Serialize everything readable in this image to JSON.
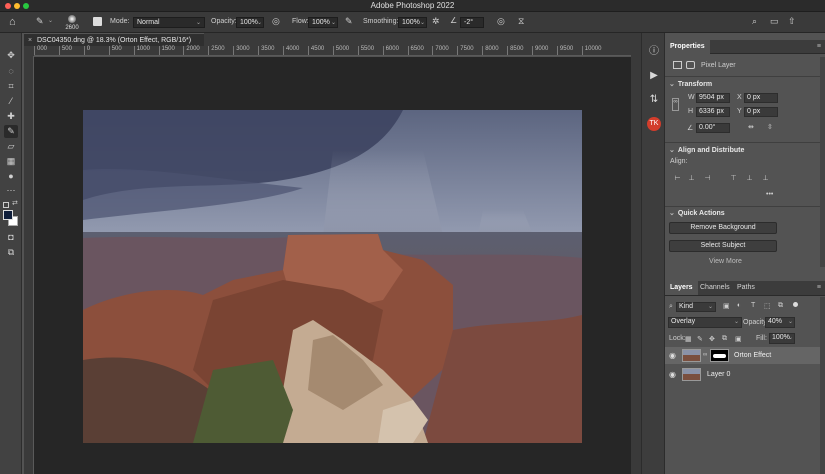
{
  "app": {
    "title": "Adobe Photoshop 2022"
  },
  "options_bar": {
    "brush_size": "2600",
    "mode_label": "Mode:",
    "mode_value": "Normal",
    "opacity_label": "Opacity:",
    "opacity_value": "100%",
    "flow_label": "Flow:",
    "flow_value": "100%",
    "smoothing_label": "Smoothing:",
    "smoothing_value": "100%",
    "angle_value": "-2°"
  },
  "document": {
    "tab_title": "DSC04350.dng @ 18.3% (Orton Effect, RGB/16*)",
    "close_glyph": "×"
  },
  "ruler": {
    "ticks": [
      "000",
      "500",
      "0",
      "500",
      "1000",
      "1500",
      "2000",
      "2500",
      "3000",
      "3500",
      "4000",
      "4500",
      "5000",
      "5500",
      "6000",
      "6500",
      "7000",
      "7500",
      "8000",
      "8500",
      "9000",
      "9500",
      "10000"
    ]
  },
  "properties": {
    "tab_label": "Properties",
    "pixel_layer_label": "Pixel Layer",
    "transform_label": "Transform",
    "w_label": "W",
    "w_value": "9504 px",
    "h_label": "H",
    "h_value": "6336 px",
    "x_label": "X",
    "x_value": "0 px",
    "y_label": "Y",
    "y_value": "0 px",
    "angle_value": "0.00°",
    "align_label": "Align and Distribute",
    "align_sub": "Align:",
    "more_glyph": "•••",
    "quick_actions_label": "Quick Actions",
    "remove_bg_button": "Remove Background",
    "select_subject_button": "Select Subject",
    "view_more": "View More"
  },
  "layers_panel": {
    "tabs": [
      "Layers",
      "Channels",
      "Paths"
    ],
    "filter_label": "Kind",
    "blend_mode": "Overlay",
    "opacity_label": "Opacity:",
    "opacity_value": "40%",
    "lock_label": "Lock:",
    "fill_label": "Fill:",
    "fill_value": "100%",
    "layers": [
      {
        "name": "Orton Effect",
        "selected": true
      },
      {
        "name": "Layer 0",
        "selected": false
      }
    ]
  },
  "icons": [
    "home-icon",
    "brush-icon",
    "search-icon",
    "share-icon",
    "info-icon",
    "play-icon",
    "eye-icon",
    "pressure-icon",
    "settings-icon",
    "move-icon",
    "marquee-icon",
    "lasso-icon",
    "crop-icon",
    "eyedropper-icon",
    "healing-icon",
    "eraser-icon",
    "gradient-icon",
    "dodge-icon",
    "pen-icon",
    "text-icon",
    "hand-icon",
    "zoom-icon"
  ],
  "colors": {
    "accent": "#d33d2b",
    "canvas_bg": "#262626",
    "panel_bg": "#535353"
  }
}
